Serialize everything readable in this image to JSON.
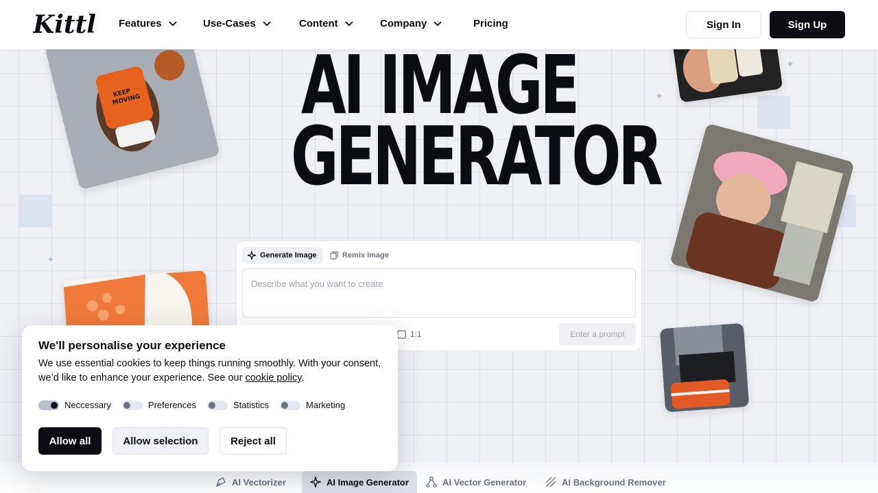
{
  "header": {
    "logo_text": "Kittl",
    "nav": [
      {
        "label": "Features",
        "has_dropdown": true
      },
      {
        "label": "Use-Cases",
        "has_dropdown": true
      },
      {
        "label": "Content",
        "has_dropdown": true
      },
      {
        "label": "Company",
        "has_dropdown": true
      },
      {
        "label": "Pricing",
        "has_dropdown": false
      }
    ],
    "sign_in": "Sign In",
    "sign_up": "Sign Up"
  },
  "hero": {
    "title_line1": "AI IMAGE",
    "title_line2": "GENERATOR"
  },
  "prompt_card": {
    "tab_generate": "Generate Image",
    "tab_remix": "Remix Image",
    "placeholder": "Describe what you want to create",
    "aspect_ratio": "1:1",
    "submit_label": "Enter a prompt"
  },
  "cookie_banner": {
    "title": "We'll personalise your experience",
    "text_before": "We use essential cookies to keep things running smoothly. With your consent, we’d like to enhance your experience. See our ",
    "link_text": "cookie policy",
    "text_after": ".",
    "toggles": [
      {
        "label": "Neccessary",
        "on": true
      },
      {
        "label": "Preferences",
        "on": false
      },
      {
        "label": "Statistics",
        "on": false
      },
      {
        "label": "Marketing",
        "on": false
      }
    ],
    "allow_all": "Allow all",
    "allow_selection": "Allow selection",
    "reject_all": "Reject all"
  },
  "bottom_tabs": [
    {
      "label": "AI Vectorizer",
      "icon": "pen-tool-icon",
      "active": false
    },
    {
      "label": "AI Image Generator",
      "icon": "sparkle-icon",
      "active": true
    },
    {
      "label": "AI Vector Generator",
      "icon": "vector-path-icon",
      "active": false
    },
    {
      "label": "AI Background Remover",
      "icon": "hatch-icon",
      "active": false
    }
  ],
  "colors": {
    "primary": "#0b0d12",
    "background": "#eff1f5",
    "muted_text": "#6b7280"
  }
}
